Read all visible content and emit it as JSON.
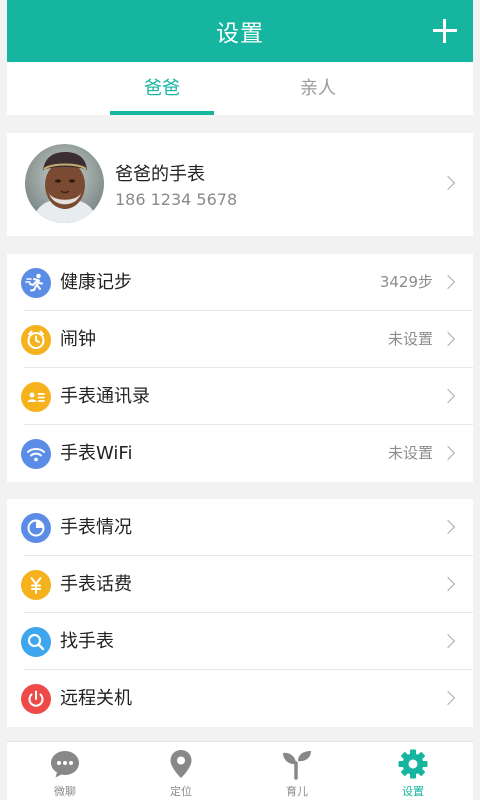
{
  "header": {
    "title": "设置"
  },
  "tabs": [
    {
      "label": "爸爸"
    },
    {
      "label": "亲人"
    }
  ],
  "profile": {
    "name": "爸爸的手表",
    "phone": "186 1234 5678"
  },
  "groups": [
    [
      {
        "icon": "running-icon",
        "color": "#5b8de6",
        "label": "健康记步",
        "value": "3429步"
      },
      {
        "icon": "alarm-clock-icon",
        "color": "#f5b21c",
        "label": "闹钟",
        "value": "未设置"
      },
      {
        "icon": "contacts-card-icon",
        "color": "#f5b21c",
        "label": "手表通讯录",
        "value": ""
      },
      {
        "icon": "wifi-icon",
        "color": "#5b8de6",
        "label": "手表WiFi",
        "value": "未设置"
      }
    ],
    [
      {
        "icon": "pie-chart-icon",
        "color": "#5b8de6",
        "label": "手表情况",
        "value": ""
      },
      {
        "icon": "yuan-icon",
        "color": "#f5b21c",
        "label": "手表话费",
        "value": ""
      },
      {
        "icon": "search-icon",
        "color": "#3ea5ef",
        "label": "找手表",
        "value": ""
      },
      {
        "icon": "power-icon",
        "color": "#ee4a4a",
        "label": "远程关机",
        "value": ""
      }
    ]
  ],
  "nav": [
    {
      "icon": "chat-bubble-icon",
      "label": "微聊"
    },
    {
      "icon": "location-pin-icon",
      "label": "定位"
    },
    {
      "icon": "sprout-icon",
      "label": "育儿"
    },
    {
      "icon": "gear-icon",
      "label": "设置",
      "active": true
    }
  ]
}
